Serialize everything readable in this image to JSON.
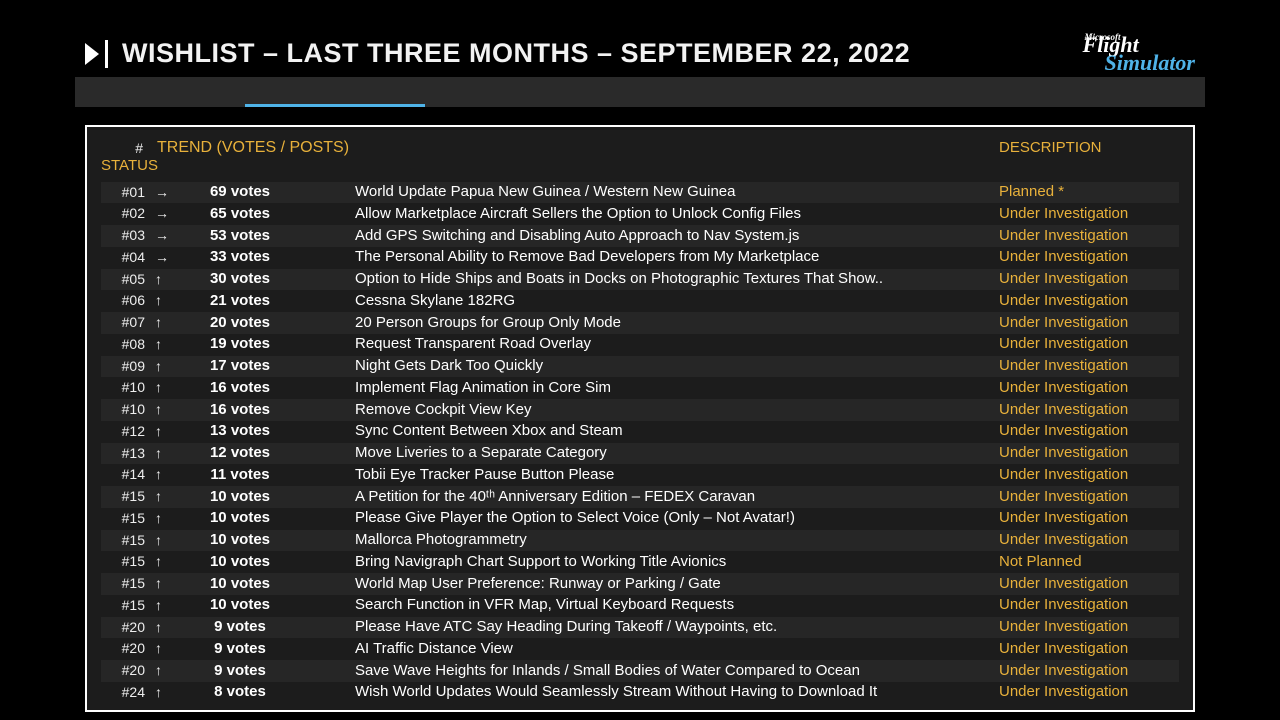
{
  "header": {
    "title": "WISHLIST – LAST THREE MONTHS – SEPTEMBER 22, 2022",
    "logo_brand": "Microsoft",
    "logo_line1": "Flight",
    "logo_line2": "Simulator"
  },
  "columns": {
    "rank": "#",
    "trend": "TREND  (VOTES / POSTS)",
    "desc": "DESCRIPTION",
    "status": "STATUS"
  },
  "rows": [
    {
      "rank": "#01",
      "trend": "→",
      "votes": "69 votes",
      "desc": "World Update Papua New Guinea / Western New Guinea",
      "status": "Planned *"
    },
    {
      "rank": "#02",
      "trend": "→",
      "votes": "65 votes",
      "desc": "Allow Marketplace Aircraft Sellers the Option to Unlock Config Files",
      "status": "Under Investigation"
    },
    {
      "rank": "#03",
      "trend": "→",
      "votes": "53 votes",
      "desc": "Add GPS Switching and Disabling Auto Approach to Nav System.js",
      "status": "Under Investigation"
    },
    {
      "rank": "#04",
      "trend": "→",
      "votes": "33 votes",
      "desc": "The Personal Ability to Remove Bad Developers from My Marketplace",
      "status": "Under Investigation"
    },
    {
      "rank": "#05",
      "trend": "↑",
      "votes": "30 votes",
      "desc": "Option to Hide Ships and Boats in Docks on Photographic Textures That Show..",
      "status": "Under Investigation"
    },
    {
      "rank": "#06",
      "trend": "↑",
      "votes": "21 votes",
      "desc": "Cessna Skylane 182RG",
      "status": "Under Investigation"
    },
    {
      "rank": "#07",
      "trend": "↑",
      "votes": "20 votes",
      "desc": "20 Person Groups for Group Only Mode",
      "status": "Under Investigation"
    },
    {
      "rank": "#08",
      "trend": "↑",
      "votes": "19 votes",
      "desc": "Request Transparent Road Overlay",
      "status": "Under Investigation"
    },
    {
      "rank": "#09",
      "trend": "↑",
      "votes": "17 votes",
      "desc": "Night Gets Dark Too Quickly",
      "status": "Under Investigation"
    },
    {
      "rank": "#10",
      "trend": "↑",
      "votes": "16 votes",
      "desc": "Implement Flag Animation in Core Sim",
      "status": "Under Investigation"
    },
    {
      "rank": "#10",
      "trend": "↑",
      "votes": "16 votes",
      "desc": "Remove Cockpit View Key",
      "status": "Under Investigation"
    },
    {
      "rank": "#12",
      "trend": "↑",
      "votes": "13 votes",
      "desc": "Sync Content Between Xbox and Steam",
      "status": "Under Investigation"
    },
    {
      "rank": "#13",
      "trend": "↑",
      "votes": "12 votes",
      "desc": "Move Liveries to a Separate Category",
      "status": "Under Investigation"
    },
    {
      "rank": "#14",
      "trend": "↑",
      "votes": "11 votes",
      "desc": "Tobii Eye Tracker Pause Button Please",
      "status": "Under Investigation"
    },
    {
      "rank": "#15",
      "trend": "↑",
      "votes": "10 votes",
      "desc": "A Petition for the 40ᵗʰ Anniversary Edition – FEDEX Caravan",
      "status": "Under Investigation"
    },
    {
      "rank": "#15",
      "trend": "↑",
      "votes": "10 votes",
      "desc": "Please Give Player the Option to Select Voice (Only – Not Avatar!)",
      "status": "Under Investigation"
    },
    {
      "rank": "#15",
      "trend": "↑",
      "votes": "10 votes",
      "desc": "Mallorca Photogrammetry",
      "status": "Under Investigation"
    },
    {
      "rank": "#15",
      "trend": "↑",
      "votes": "10 votes",
      "desc": "Bring Navigraph Chart Support to Working Title Avionics",
      "status": "Not Planned"
    },
    {
      "rank": "#15",
      "trend": "↑",
      "votes": "10 votes",
      "desc": "World Map User Preference: Runway or Parking / Gate",
      "status": "Under Investigation"
    },
    {
      "rank": "#15",
      "trend": "↑",
      "votes": "10 votes",
      "desc": "Search Function in VFR Map, Virtual Keyboard Requests",
      "status": "Under Investigation"
    },
    {
      "rank": "#20",
      "trend": "↑",
      "votes": "9 votes",
      "desc": "Please Have ATC Say Heading During Takeoff / Waypoints, etc.",
      "status": "Under Investigation"
    },
    {
      "rank": "#20",
      "trend": "↑",
      "votes": "9 votes",
      "desc": "AI Traffic Distance View",
      "status": "Under Investigation"
    },
    {
      "rank": "#20",
      "trend": "↑",
      "votes": "9 votes",
      "desc": "Save Wave Heights for Inlands / Small Bodies of Water Compared to Ocean",
      "status": "Under Investigation"
    },
    {
      "rank": "#24",
      "trend": "↑",
      "votes": "8 votes",
      "desc": "Wish World Updates Would Seamlessly Stream Without Having to Download It",
      "status": "Under Investigation"
    }
  ]
}
